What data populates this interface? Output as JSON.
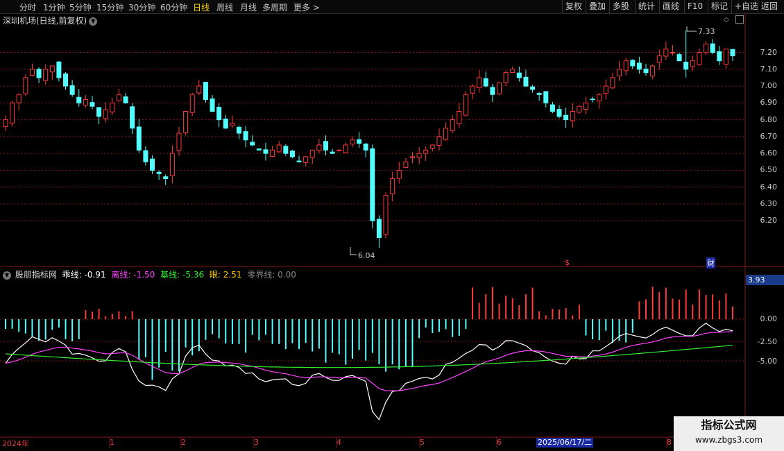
{
  "toolbar": {
    "periods": [
      "分时",
      "1分钟",
      "5分钟",
      "15分钟",
      "30分钟",
      "60分钟",
      "日线",
      "周线",
      "月线",
      "多周期",
      "更多 >"
    ],
    "active": "日线",
    "right": [
      "复权",
      "叠加",
      "多股",
      "统计",
      "画线",
      "F10",
      "标记",
      "+自选",
      "返回"
    ]
  },
  "stock": {
    "title": "深圳机场(日线,前复权)"
  },
  "price_axis": [
    "7.20",
    "7.10",
    "7.00",
    "6.90",
    "6.80",
    "6.70",
    "6.60",
    "6.50",
    "6.40",
    "6.30",
    "6.20"
  ],
  "extremes": {
    "high": "7.33",
    "low": "6.04"
  },
  "markers": {
    "s": "$",
    "cai": "财"
  },
  "indicator": {
    "name": "股朋指标网",
    "chengxian": "乖线: -0.91",
    "lixian": "离线: -1.50",
    "jixian": "基线: -5.36",
    "yan": "眼: 2.51",
    "lingjie": "零界线: 0.00",
    "badge": "3.93",
    "axis": [
      "0.00",
      "-2.50",
      "-5.00"
    ]
  },
  "xaxis": {
    "labels": [
      "2024年",
      "1",
      "2",
      "3",
      "4",
      "5",
      "6",
      "8"
    ],
    "highlight": "2025/06/17/二"
  },
  "colors": {
    "up": "#ff3c3c",
    "down": "#54ffff",
    "white": "#ffffff",
    "magenta": "#ff44ff",
    "green": "#33ee33",
    "grid": "#8a1818"
  },
  "watermark": {
    "line1": "指标公式网",
    "line2": "www.zbgs3.com"
  },
  "chart_data": {
    "type": "candlestick",
    "title": "深圳机场(日线,前复权)",
    "ylim": [
      6.04,
      7.33
    ],
    "closes": [
      6.8,
      6.9,
      6.95,
      7.05,
      7.1,
      7.05,
      7.1,
      7.12,
      7.05,
      7.0,
      6.95,
      6.9,
      6.92,
      6.88,
      6.82,
      6.86,
      6.9,
      6.95,
      6.9,
      6.75,
      6.62,
      6.55,
      6.5,
      6.48,
      6.45,
      6.6,
      6.72,
      6.85,
      6.95,
      7.0,
      6.92,
      6.85,
      6.8,
      6.75,
      6.78,
      6.72,
      6.68,
      6.65,
      6.62,
      6.6,
      6.62,
      6.65,
      6.6,
      6.58,
      6.55,
      6.58,
      6.62,
      6.65,
      6.62,
      6.6,
      6.62,
      6.65,
      6.68,
      6.66,
      6.62,
      6.2,
      6.1,
      6.35,
      6.45,
      6.5,
      6.55,
      6.58,
      6.6,
      6.62,
      6.65,
      6.7,
      6.75,
      6.8,
      6.85,
      6.95,
      7.0,
      7.05,
      7.0,
      6.95,
      7.02,
      7.08,
      7.1,
      7.05,
      7.0,
      6.98,
      6.95,
      6.9,
      6.85,
      6.82,
      6.8,
      6.85,
      6.88,
      6.9,
      6.92,
      6.95,
      7.0,
      7.05,
      7.1,
      7.15,
      7.12,
      7.1,
      7.08,
      7.12,
      7.18,
      7.22,
      7.2,
      7.15,
      7.1,
      7.15,
      7.2,
      7.25,
      7.2,
      7.15,
      7.22,
      7.18
    ],
    "high_label": "7.33",
    "low_label": "6.04"
  }
}
